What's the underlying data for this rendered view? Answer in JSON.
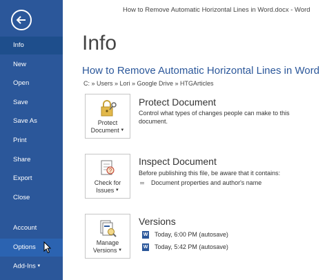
{
  "window": {
    "title": "How to Remove Automatic Horizontal Lines in Word.docx - Word"
  },
  "sidebar": {
    "items": [
      {
        "label": "Info"
      },
      {
        "label": "New"
      },
      {
        "label": "Open"
      },
      {
        "label": "Save"
      },
      {
        "label": "Save As"
      },
      {
        "label": "Print"
      },
      {
        "label": "Share"
      },
      {
        "label": "Export"
      },
      {
        "label": "Close"
      },
      {
        "label": "Account"
      },
      {
        "label": "Options"
      },
      {
        "label": "Add-Ins"
      }
    ],
    "selected": "Info",
    "hovered": "Options"
  },
  "main": {
    "title": "Info",
    "doc_title": "How to Remove Automatic Horizontal Lines in Word",
    "path": "C: » Users » Lori » Google Drive » HTGArticles",
    "protect": {
      "button_line1": "Protect",
      "button_line2": "Document",
      "heading": "Protect Document",
      "description": "Control what types of changes people can make to this document."
    },
    "inspect": {
      "button_line1": "Check for",
      "button_line2": "Issues",
      "heading": "Inspect Document",
      "description": "Before publishing this file, be aware that it contains:",
      "bullet": "Document properties and author's name"
    },
    "versions": {
      "button_line1": "Manage",
      "button_line2": "Versions",
      "heading": "Versions",
      "entries": [
        {
          "label": "Today, 6:00 PM (autosave)"
        },
        {
          "label": "Today, 5:42 PM (autosave)"
        }
      ]
    }
  },
  "colors": {
    "sidebar_bg": "#2b579a",
    "accent": "#2b579a"
  }
}
